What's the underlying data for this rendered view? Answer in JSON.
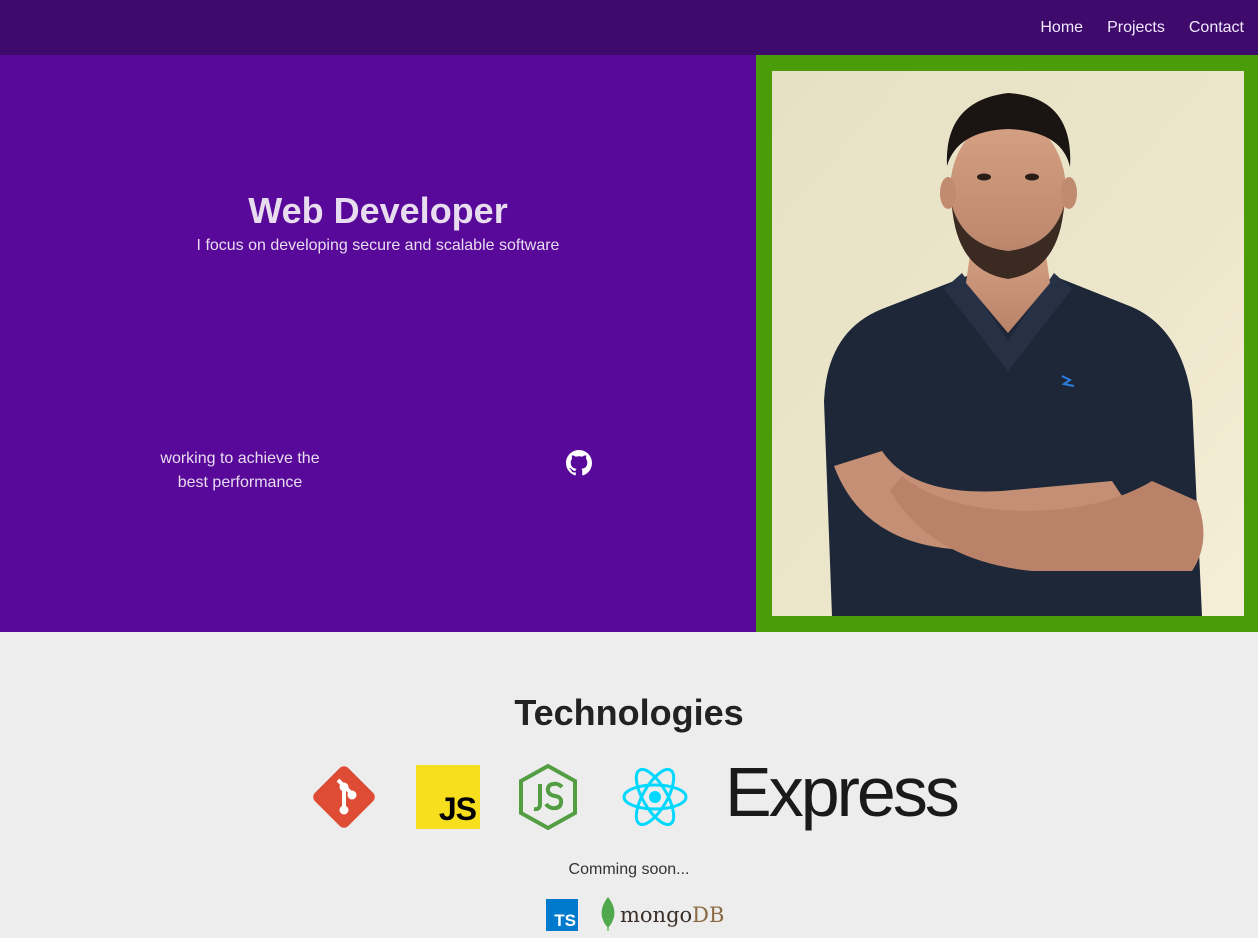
{
  "nav": {
    "links": [
      "Home",
      "Projects",
      "Contact"
    ]
  },
  "hero": {
    "title": "Web Developer",
    "subtitle": "I focus on developing secure and scalable software",
    "tagline_line1": "working to achieve the",
    "tagline_line2": "best performance",
    "github_icon": "github-icon",
    "portrait_icon": "profile-photo"
  },
  "technologies": {
    "title": "Technologies",
    "logos": [
      "git-logo",
      "javascript-logo",
      "nodejs-logo",
      "react-logo",
      "express-logo"
    ],
    "js_text": "JS",
    "express_text": "Express",
    "coming_soon": "Comming soon...",
    "ts_text": "TS",
    "mongo_text": "mongo",
    "mongo_db_text": "DB"
  },
  "colors": {
    "navbar": "#3e0a6b",
    "hero_left": "#59099a",
    "hero_right": "#4a9c09",
    "page_bg": "#ededed",
    "git": "#de4c36",
    "js": "#f7df1e",
    "node": "#539e43",
    "react": "#00d8ff",
    "ts": "#007acc",
    "mongo_leaf": "#4fa94d"
  }
}
